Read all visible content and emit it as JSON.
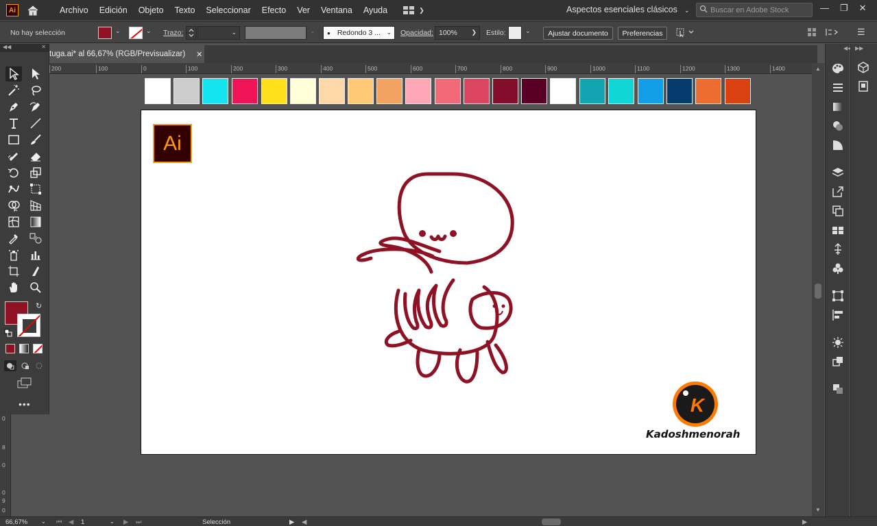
{
  "app": {
    "logo_text": "Ai"
  },
  "menubar": {
    "items": [
      "Archivo",
      "Edición",
      "Objeto",
      "Texto",
      "Seleccionar",
      "Efecto",
      "Ver",
      "Ventana",
      "Ayuda"
    ],
    "workspace": "Aspectos esenciales clásicos",
    "stock_placeholder": "Buscar en Adobe Stock"
  },
  "control_bar": {
    "selection_status": "No hay selección",
    "stroke_label": "Trazo:",
    "brush_profile": "Redondo 3 ...",
    "opacity_label": "Opacidad:",
    "opacity_value": "100%",
    "style_label": "Estilo:",
    "fit_button": "Ajustar documento",
    "prefs_button": "Preferencias",
    "fill_color": "#8e1124"
  },
  "document": {
    "tab_title": "tuga.ai* al 66,67% (RGB/Previsualizar)"
  },
  "ruler": {
    "h_ticks": [
      "200",
      "100",
      "0",
      "100",
      "200",
      "300",
      "400",
      "500",
      "600",
      "700",
      "800",
      "900",
      "1000",
      "1100",
      "1200",
      "1300",
      "1400"
    ],
    "v_ticks": [
      "0",
      "8",
      "0",
      "0",
      "9",
      "0"
    ]
  },
  "canvas": {
    "swatches": [
      "#ffffff",
      "#cccccc",
      "#14e3f0",
      "#f01358",
      "#ffe01a",
      "#ffffd8",
      "#ffd8a8",
      "#ffc975",
      "#f2a261",
      "#ffa6b7",
      "#f26977",
      "#db4560",
      "#850d2c",
      "#5a0025",
      "#ffffff",
      "#13a4b2",
      "#11d6d6",
      "#139fe8",
      "#053c6e",
      "#ed6c30",
      "#d94110"
    ],
    "ai_badge": "Ai",
    "brand_initial": "K",
    "brand_name": "Kadoshmenorah",
    "illustration_color": "#8e1124"
  },
  "status": {
    "zoom": "66,67%",
    "artboard_num": "1",
    "tool_name": "Selección"
  }
}
